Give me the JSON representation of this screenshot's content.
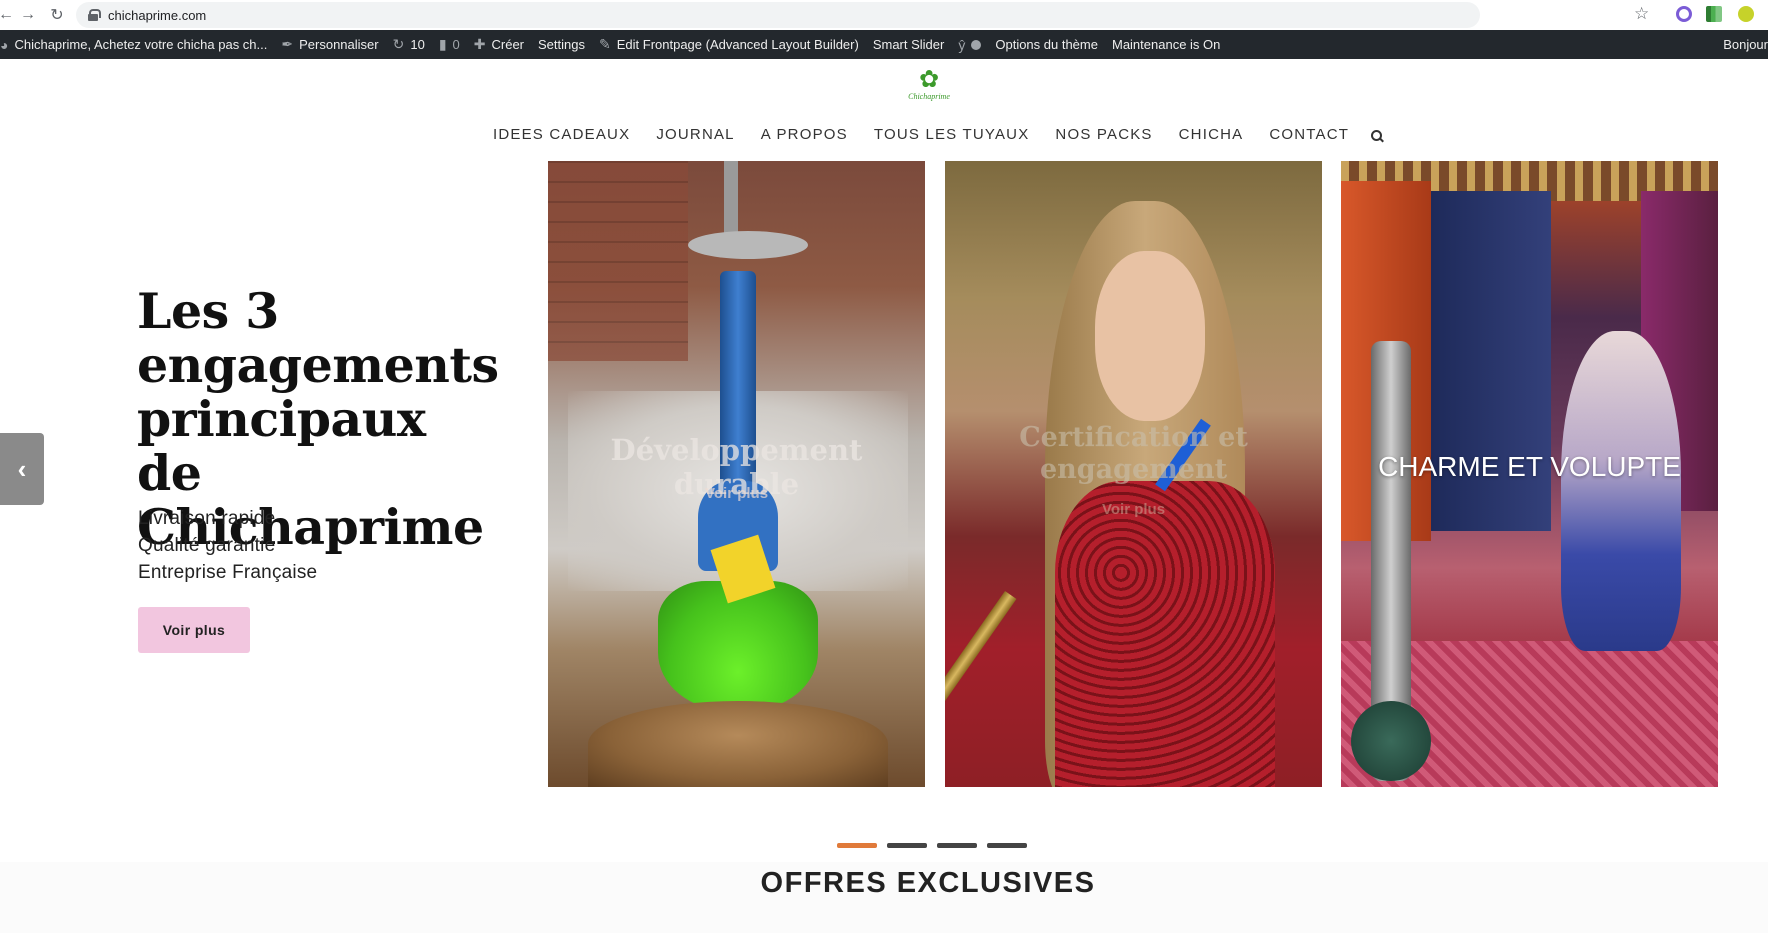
{
  "browser": {
    "url": "chichaprime.com"
  },
  "adminbar": {
    "site_name": "Chichaprime, Achetez votre chicha pas ch...",
    "customize": "Personnaliser",
    "updates_count": "10",
    "comments_count": "0",
    "create": "Créer",
    "settings": "Settings",
    "edit_frontpage": "Edit Frontpage (Advanced Layout Builder)",
    "smart_slider": "Smart Slider",
    "theme_options": "Options du thème",
    "maintenance": "Maintenance is On",
    "greeting": "Bonjour"
  },
  "logo": {
    "text": "Chichaprime"
  },
  "nav": {
    "items": [
      "IDEES CADEAUX",
      "JOURNAL",
      "A PROPOS",
      "TOUS LES TUYAUX",
      "NOS PACKS",
      "CHICHA",
      "CONTACT"
    ]
  },
  "hero": {
    "title": "Les 3 engagements principaux de Chichaprime",
    "lines": [
      "Livraison rapide",
      "Qualité garantie",
      "Entreprise Française"
    ],
    "button": "Voir plus"
  },
  "cards": [
    {
      "title": "Développement durable",
      "link": "Voir plus"
    },
    {
      "title": "Certification et engagement",
      "link": "Voir plus"
    },
    {
      "title": "CHARME ET VOLUPTE"
    }
  ],
  "slider": {
    "active_index": 0,
    "count": 4
  },
  "section": {
    "title": "OFFRES EXCLUSIVES"
  },
  "colors": {
    "adminbar_bg": "#23282d",
    "button_pink": "#f2c6df",
    "dot_active": "#e07a3a",
    "dot_inactive": "#444444"
  }
}
